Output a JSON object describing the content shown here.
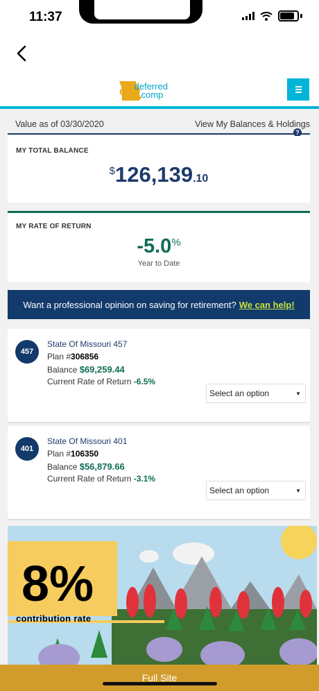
{
  "status_bar": {
    "time": "11:37"
  },
  "header": {
    "logo_mo": "mo",
    "logo_line1": "deferred",
    "logo_line2": "comp"
  },
  "value_row": {
    "date_text": "Value as of 03/30/2020",
    "link_text": "View My Balances & Holdings",
    "help_glyph": "?"
  },
  "balance": {
    "label": "MY TOTAL BALANCE",
    "currency": "$",
    "main": "126,139",
    "cents": ".10"
  },
  "rate": {
    "label": "MY RATE OF RETURN",
    "main": "-5.0",
    "percent": "%",
    "sub": "Year to Date"
  },
  "promo": {
    "text": "Want a professional opinion on saving for retirement?",
    "link": "We can help!"
  },
  "plans": [
    {
      "badge": "457",
      "name": "State Of Missouri 457",
      "plan_label": "Plan #",
      "plan_number": "306856",
      "balance_label": "Balance",
      "balance": "$69,259.44",
      "rate_label": "Current Rate of Return",
      "rate": "-6.5%",
      "select": "Select an option"
    },
    {
      "badge": "401",
      "name": "State Of Missouri 401",
      "plan_label": "Plan #",
      "plan_number": "106350",
      "balance_label": "Balance",
      "balance": "$56,879.66",
      "rate_label": "Current Rate of Return",
      "rate": "-3.1%",
      "select": "Select an option"
    }
  ],
  "banner": {
    "big": "8%",
    "small": "contribution rate"
  },
  "footer": {
    "full_site": "Full Site"
  },
  "colors": {
    "navy": "#1e3a6b",
    "teal": "#00b5d8",
    "green": "#0f6e55",
    "gold": "#d29c2d",
    "lime": "#c6e53c"
  }
}
